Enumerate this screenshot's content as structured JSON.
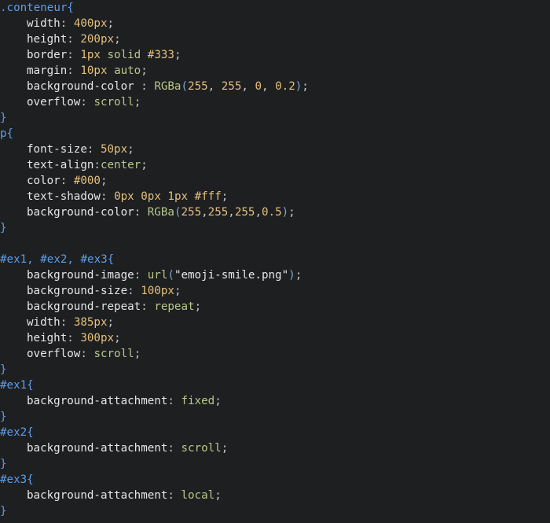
{
  "code": {
    "lines": [
      ".conteneur{",
      "    width: 400px;",
      "    height: 200px;",
      "    border: 1px solid #333;",
      "    margin: 10px auto;",
      "    background-color : RGBa(255, 255, 0, 0.2);",
      "    overflow: scroll;",
      "}",
      "p{",
      "    font-size: 50px;",
      "    text-align:center;",
      "    color: #000;",
      "    text-shadow: 0px 0px 1px #fff;",
      "    background-color: RGBa(255,255,255,0.5);",
      "}",
      "",
      "#ex1, #ex2, #ex3{",
      "    background-image: url(\"emoji-smile.png\");",
      "    background-size: 100px;",
      "    background-repeat: repeat;",
      "    width: 385px;",
      "    height: 300px;",
      "    overflow: scroll;",
      "}",
      "#ex1{",
      "    background-attachment: fixed;",
      "}",
      "#ex2{",
      "    background-attachment: scroll;",
      "}",
      "#ex3{",
      "    background-attachment: local;",
      "}"
    ]
  },
  "colors": {
    "background": "#1d1f21",
    "selector": "#5e9de8",
    "property": "#e6e6e6",
    "number": "#e5c07b",
    "keyword": "#b9c88a"
  }
}
